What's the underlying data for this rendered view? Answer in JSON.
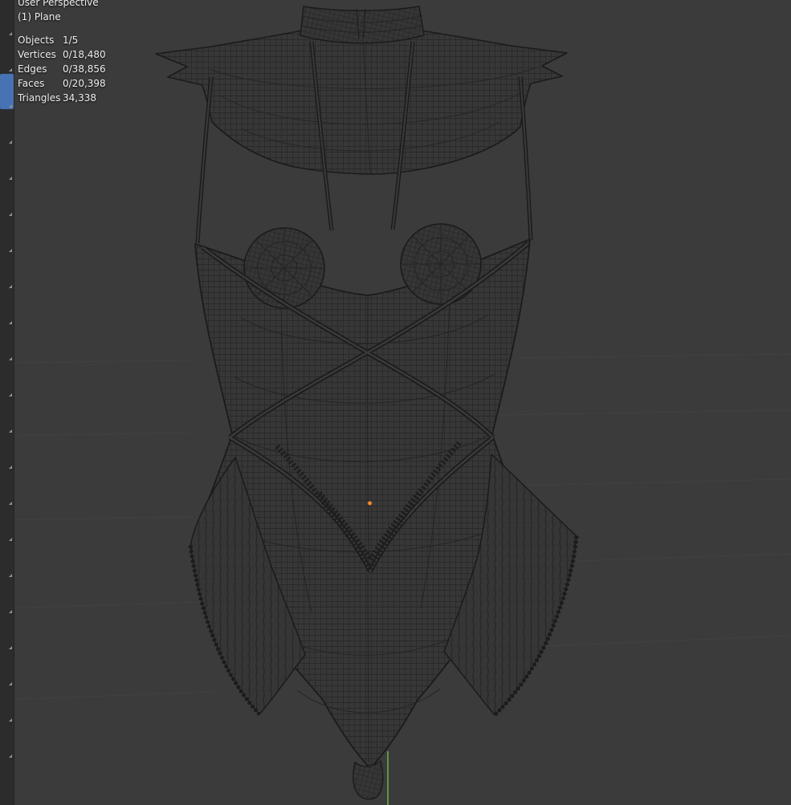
{
  "header": {
    "view_label": "User Perspective",
    "collection_label": "(1) Plane"
  },
  "stats": {
    "rows": [
      {
        "label": "Objects",
        "value": "1/5"
      },
      {
        "label": "Vertices",
        "value": "0/18,480"
      },
      {
        "label": "Edges",
        "value": "0/38,856"
      },
      {
        "label": "Faces",
        "value": "0/20,398"
      },
      {
        "label": "Triangles",
        "value": "34,338"
      }
    ]
  },
  "toolbar": {
    "slot_count": 21,
    "active_index": 2
  },
  "colors": {
    "viewport_bg": "#3b3b3b",
    "toolbar_bg": "#2c2c2c",
    "active_tool_blue": "#4772b3",
    "wireframe_line": "#1b1b1b",
    "mesh_fill": "#373737",
    "floor_grid": "#434343",
    "axis_green": "#6fae3c",
    "origin_orange": "#ef9038",
    "overlay_text": "#eeeeee"
  }
}
